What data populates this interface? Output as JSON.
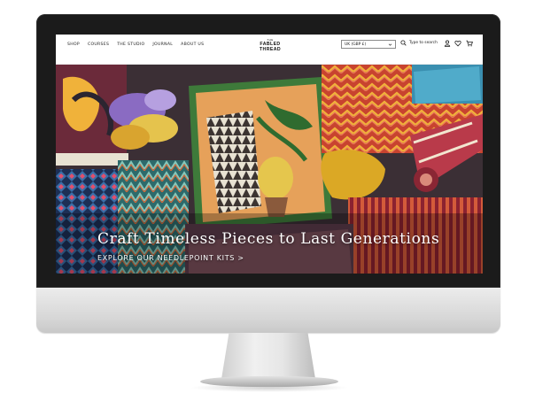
{
  "nav": {
    "items": [
      {
        "label": "SHOP"
      },
      {
        "label": "COURSES"
      },
      {
        "label": "THE STUDIO"
      },
      {
        "label": "JOURNAL"
      },
      {
        "label": "ABOUT US"
      }
    ]
  },
  "logo": {
    "line1": "THE",
    "line2": "FABLED",
    "line3": "THREAD"
  },
  "header": {
    "currency": "UK (GBP £)",
    "search_placeholder": "Type to search",
    "icons": [
      "search-icon",
      "account-icon",
      "wishlist-icon",
      "cart-icon"
    ]
  },
  "hero": {
    "title": "Craft Timeless Pieces to Last Generations",
    "cta": "EXPLORE OUR NEEDLEPOINT KITS >"
  },
  "colors": {
    "bezel": "#1b1b1b",
    "chin": "#dcdcdc",
    "text_dark": "#1a1a1a",
    "hero_text": "#ffffff"
  }
}
